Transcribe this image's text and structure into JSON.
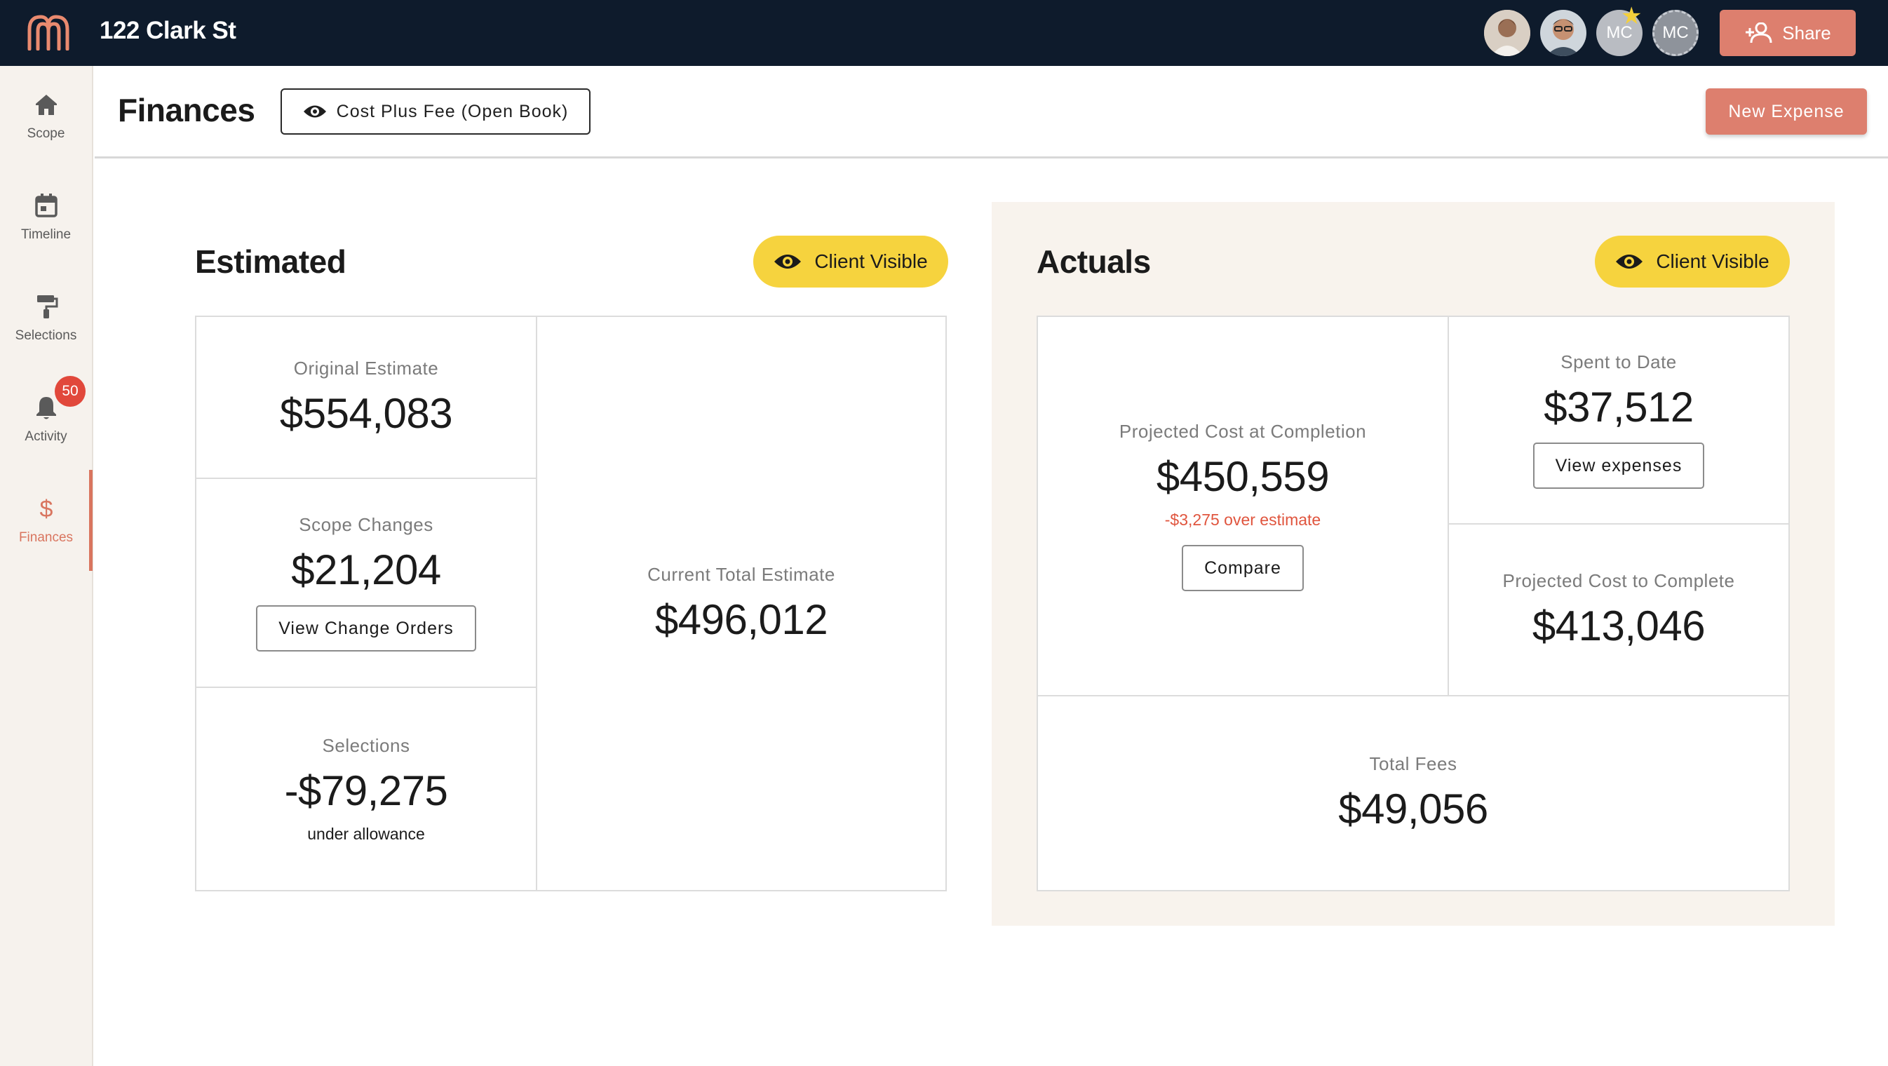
{
  "topbar": {
    "project_title": "122 Clark St",
    "avatars": [
      {
        "name": "user-avatar-1",
        "initials": ""
      },
      {
        "name": "user-avatar-2",
        "initials": ""
      },
      {
        "name": "user-avatar-mc-owner",
        "initials": "MC"
      },
      {
        "name": "user-avatar-mc-invited",
        "initials": "MC"
      }
    ],
    "share_label": "Share"
  },
  "sidebar": {
    "items": [
      {
        "label": "Scope",
        "icon": "home-icon"
      },
      {
        "label": "Timeline",
        "icon": "calendar-icon"
      },
      {
        "label": "Selections",
        "icon": "paint-roller-icon"
      },
      {
        "label": "Activity",
        "icon": "bell-icon"
      },
      {
        "label": "Finances",
        "icon": "dollar-icon"
      }
    ],
    "activity_badge": "50",
    "active": "Finances"
  },
  "header": {
    "title": "Finances",
    "contract_type": "Cost Plus Fee (Open Book)",
    "new_expense_label": "New Expense"
  },
  "estimated": {
    "title": "Estimated",
    "visibility": "Client Visible",
    "original_estimate": {
      "label": "Original Estimate",
      "value": "$554,083"
    },
    "scope_changes": {
      "label": "Scope Changes",
      "value": "$21,204",
      "button": "View Change Orders"
    },
    "selections": {
      "label": "Selections",
      "value": "-$79,275",
      "note": "under allowance"
    },
    "current_total": {
      "label": "Current Total Estimate",
      "value": "$496,012"
    }
  },
  "actuals": {
    "title": "Actuals",
    "visibility": "Client Visible",
    "projected_completion": {
      "label": "Projected Cost at Completion",
      "value": "$450,559",
      "note": "-$3,275 over estimate",
      "button": "Compare"
    },
    "spent_to_date": {
      "label": "Spent to Date",
      "value": "$37,512",
      "button": "View expenses"
    },
    "projected_to_complete": {
      "label": "Projected Cost to Complete",
      "value": "$413,046"
    },
    "total_fees": {
      "label": "Total Fees",
      "value": "$49,056"
    }
  },
  "colors": {
    "topbar": "#0e1b2c",
    "accent": "#dd7f6e",
    "pill": "#f6d33e",
    "negative": "#e0553e",
    "actuals_bg": "#f8f3ed"
  }
}
